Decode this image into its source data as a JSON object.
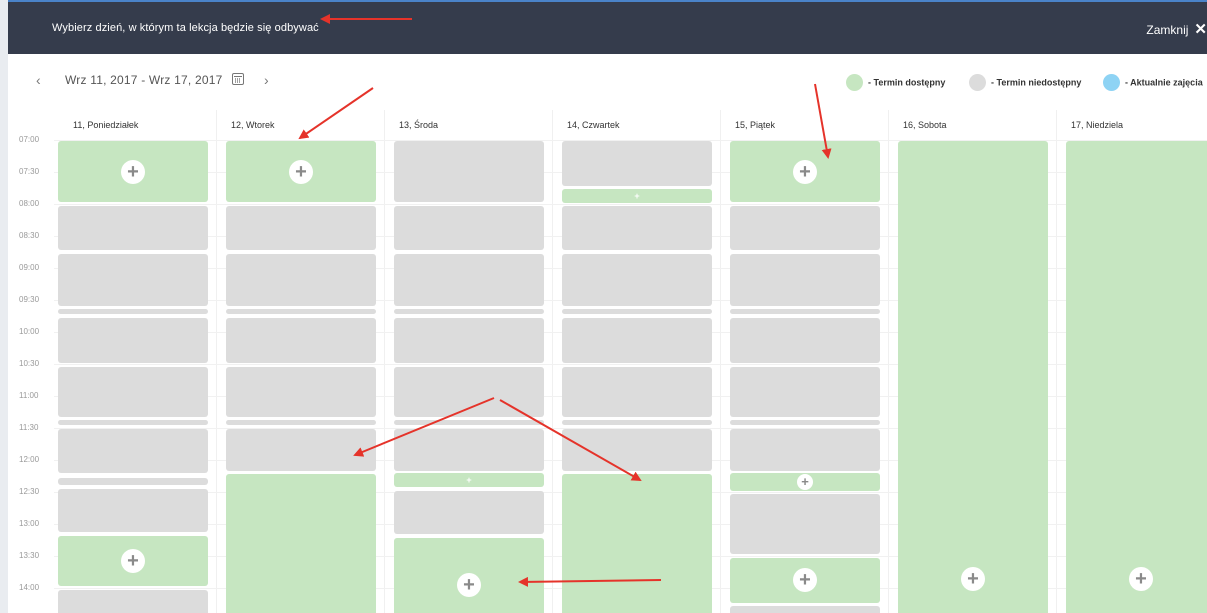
{
  "modal": {
    "title": "Wybierz dzień, w którym ta lekcja będzie się odbywać",
    "close_label": "Zamknij",
    "close_symbol": "✕"
  },
  "nav": {
    "prev_symbol": "‹",
    "next_symbol": "›",
    "range": "Wrz 11, 2017 - Wrz 17, 2017"
  },
  "legend": [
    {
      "label": "- Termin dostępny",
      "color": "#c6e6c1"
    },
    {
      "label": "- Termin niedostępny",
      "color": "#dcdcdc"
    },
    {
      "label": "- Aktualnie zajęcia",
      "color": "#8ed3f4"
    }
  ],
  "days": [
    "11, Poniedziałek",
    "12, Wtorek",
    "13, Środa",
    "14, Czwartek",
    "15, Piątek",
    "16, Sobota",
    "17, Niedziela"
  ],
  "hours": [
    "07:00",
    "07:30",
    "08:00",
    "08:30",
    "09:00",
    "09:30",
    "10:00",
    "10:30",
    "11:00",
    "11:30",
    "12:00",
    "12:30",
    "13:00",
    "13:30",
    "14:00"
  ],
  "plus_symbol": "+",
  "colors": {
    "header_bg": "#353c4c",
    "available": "#c6e6c1",
    "unavailable": "#dcdcdc",
    "current": "#8ed3f4",
    "annotation_arrow": "#e5332a"
  }
}
